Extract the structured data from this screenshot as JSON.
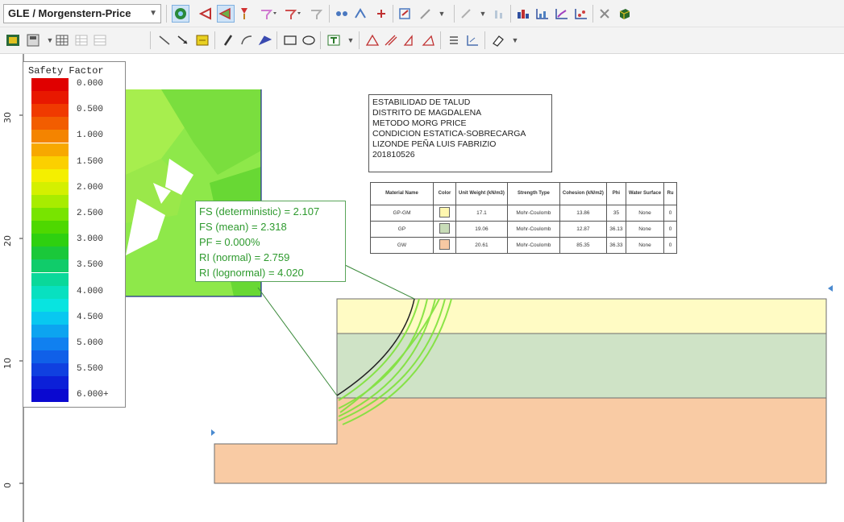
{
  "toolbar": {
    "analysis_method": "GLE / Morgenstern-Price"
  },
  "legend": {
    "title": "Safety Factor",
    "items": [
      {
        "label": "0.000",
        "color": "#e00000"
      },
      {
        "label": "",
        "color": "#e81800"
      },
      {
        "label": "0.500",
        "color": "#f03a00"
      },
      {
        "label": "",
        "color": "#f25d00"
      },
      {
        "label": "1.000",
        "color": "#f48400"
      },
      {
        "label": "",
        "color": "#f7a800"
      },
      {
        "label": "1.500",
        "color": "#fbd000"
      },
      {
        "label": "",
        "color": "#f4ef00"
      },
      {
        "label": "2.000",
        "color": "#d4f000"
      },
      {
        "label": "",
        "color": "#a8ec00"
      },
      {
        "label": "2.500",
        "color": "#78e400"
      },
      {
        "label": "",
        "color": "#4ed800"
      },
      {
        "label": "3.000",
        "color": "#2ed010"
      },
      {
        "label": "",
        "color": "#1ac83a"
      },
      {
        "label": "3.500",
        "color": "#10cc6a"
      },
      {
        "label": "",
        "color": "#0ad89a"
      },
      {
        "label": "4.000",
        "color": "#08e0c0"
      },
      {
        "label": "",
        "color": "#08e4e0"
      },
      {
        "label": "4.500",
        "color": "#08c8f0"
      },
      {
        "label": "",
        "color": "#0ca4f0"
      },
      {
        "label": "5.000",
        "color": "#1080f0"
      },
      {
        "label": "",
        "color": "#1060e8"
      },
      {
        "label": "5.500",
        "color": "#1040e0"
      },
      {
        "label": "",
        "color": "#0c20d8"
      },
      {
        "label": "6.000+",
        "color": "#0a08d0"
      }
    ]
  },
  "axis": {
    "y_ticks": [
      "30",
      "20",
      "10",
      "0"
    ]
  },
  "title_block": {
    "lines": [
      "ESTABILIDAD DE TALUD",
      "DISTRITO DE MAGDALENA",
      "METODO MORG PRICE",
      "CONDICION ESTATICA-SOBRECARGA",
      "LIZONDE PEÑA LUIS FABRIZIO",
      "201810526"
    ]
  },
  "materials": {
    "headers": [
      "Material Name",
      "Color",
      "Unit Weight (kN/m3)",
      "Strength Type",
      "Cohesion (kN/m2)",
      "Phi",
      "Water Surface",
      "Ru"
    ],
    "rows": [
      {
        "name": "GP-GM",
        "color": "#fff7b0",
        "unit_weight": "17.1",
        "strength": "Mohr-Coulomb",
        "cohesion": "13.86",
        "phi": "35",
        "water": "None",
        "ru": "0"
      },
      {
        "name": "GP",
        "color": "#c8dcb8",
        "unit_weight": "19.06",
        "strength": "Mohr-Coulomb",
        "cohesion": "12.87",
        "phi": "36.13",
        "water": "None",
        "ru": "0"
      },
      {
        "name": "GW",
        "color": "#f7c9a3",
        "unit_weight": "20.61",
        "strength": "Mohr-Coulomb",
        "cohesion": "85.35",
        "phi": "36.33",
        "water": "None",
        "ru": "0"
      }
    ]
  },
  "results": {
    "fs_det": "FS (deterministic) = 2.107",
    "fs_mean": "FS (mean) = 2.318",
    "pf": "PF = 0.000%",
    "ri_normal": "RI (normal) = 2.759",
    "ri_lognormal": "RI (lognormal) = 4.020"
  },
  "colors": {
    "layer_top": "#fffbc4",
    "layer_mid": "#cfe3c6",
    "layer_bot": "#f9cba4",
    "contour_base": "#7fe23a",
    "slip_surface": "#222222"
  }
}
